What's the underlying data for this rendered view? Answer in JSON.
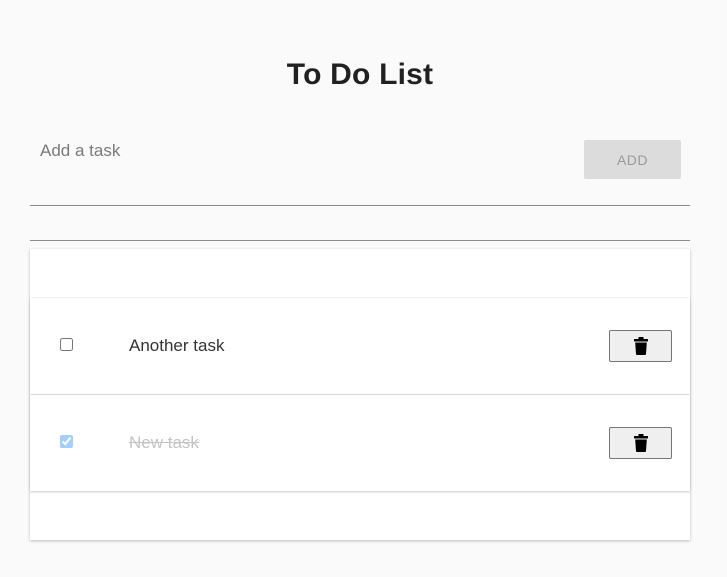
{
  "header": {
    "title": "To Do List"
  },
  "new_task": {
    "placeholder": "Add a task",
    "value": "",
    "add_label": "ADD"
  },
  "tasks": [
    {
      "label": "Another task",
      "completed": false,
      "delete_icon": "trash-icon"
    },
    {
      "label": "New task",
      "completed": true,
      "delete_icon": "trash-icon"
    }
  ],
  "colors": {
    "background": "#fafafa",
    "card": "#ffffff",
    "title_text": "#212121",
    "completed_text": "#c4c4c4",
    "add_button_bg": "#dcdcdc"
  }
}
